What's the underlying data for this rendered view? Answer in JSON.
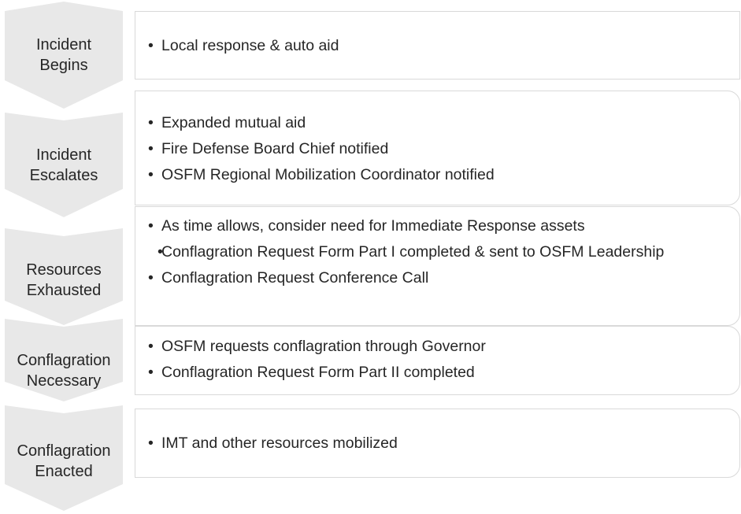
{
  "stages": [
    {
      "label_line1": "Incident",
      "label_line2": "Begins",
      "bullets": [
        "Local response & auto aid"
      ]
    },
    {
      "label_line1": "Incident",
      "label_line2": "Escalates",
      "bullets": [
        "Expanded mutual aid",
        "Fire Defense Board Chief notified",
        "OSFM Regional Mobilization Coordinator notified"
      ]
    },
    {
      "label_line1": "Resources",
      "label_line2": "Exhausted",
      "bullets": [
        "As time allows, consider need for Immediate Response assets",
        "Conflagration Request Form Part I completed & sent to OSFM Leadership",
        "Conflagration Request Conference Call"
      ]
    },
    {
      "label_line1": "Conflagration",
      "label_line2": "Necessary",
      "bullets": [
        "OSFM requests conflagration through Governor",
        "Conflagration Request Form Part II completed"
      ]
    },
    {
      "label_line1": "Conflagration",
      "label_line2": "Enacted",
      "bullets": [
        "IMT and other resources mobilized"
      ]
    }
  ],
  "colors": {
    "chevron_fill": "#e8e8e8",
    "box_border": "#d9d9d9",
    "text": "#262626"
  }
}
